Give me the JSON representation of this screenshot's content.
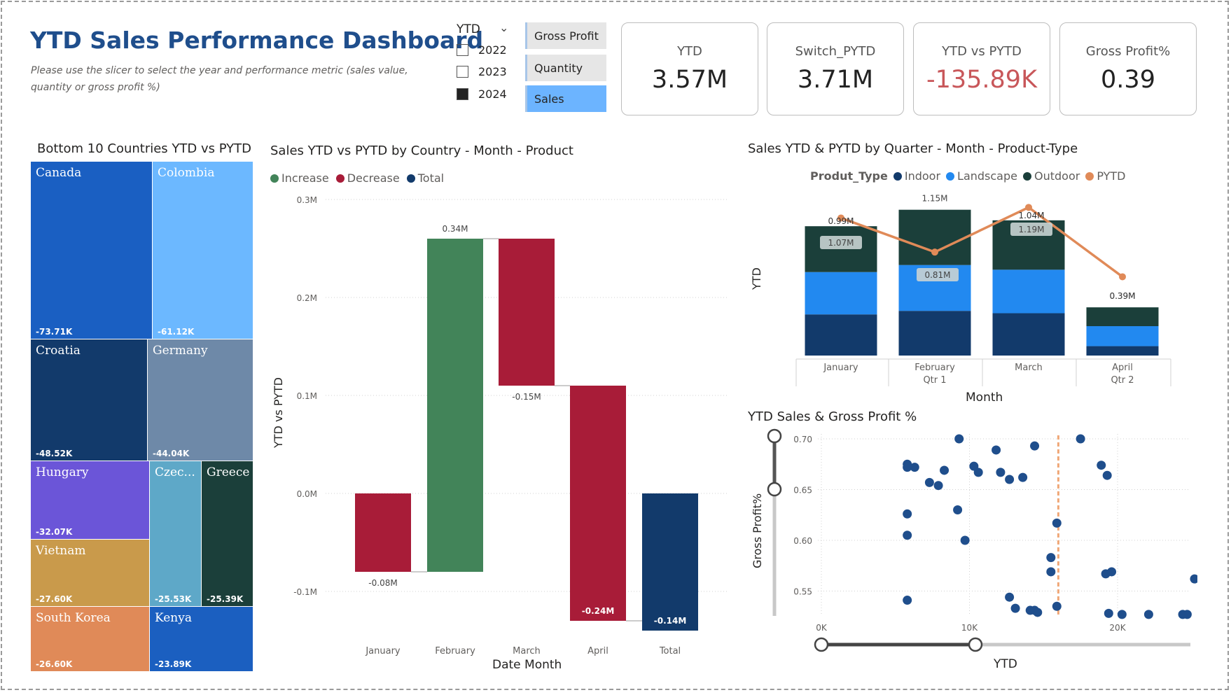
{
  "header": {
    "title": "YTD Sales Performance Dashboard",
    "subtitle": "Please use the slicer to select the year and performance metric (sales value, quantity or gross profit %)"
  },
  "year_slicer": {
    "label": "YTD",
    "years": [
      {
        "label": "2022",
        "checked": false
      },
      {
        "label": "2023",
        "checked": false
      },
      {
        "label": "2024",
        "checked": true
      }
    ]
  },
  "metric_slicer": {
    "options": [
      "Gross Profit",
      "Quantity",
      "Sales"
    ],
    "selected": "Sales"
  },
  "cards": [
    {
      "label": "YTD",
      "value": "3.57M"
    },
    {
      "label": "Switch_PYTD",
      "value": "3.71M"
    },
    {
      "label": "YTD vs PYTD",
      "value": "-135.89K"
    },
    {
      "label": "Gross Profit%",
      "value": "0.39"
    }
  ],
  "treemap": {
    "title": "Bottom 10 Countries YTD vs PYTD",
    "items": [
      {
        "name": "Canada",
        "value": "-73.71K",
        "color": "#1a5fc2"
      },
      {
        "name": "Colombia",
        "value": "-61.12K",
        "color": "#6cb8ff"
      },
      {
        "name": "Croatia",
        "value": "-48.52K",
        "color": "#123a6b"
      },
      {
        "name": "Germany",
        "value": "-44.04K",
        "color": "#6e89a8"
      },
      {
        "name": "Hungary",
        "value": "-32.07K",
        "color": "#6b55d8"
      },
      {
        "name": "Vietnam",
        "value": "-27.60K",
        "color": "#c99a4b"
      },
      {
        "name": "Czec...",
        "value": "-25.53K",
        "color": "#5ea8c8"
      },
      {
        "name": "Greece",
        "value": "-25.39K",
        "color": "#1b3f3a"
      },
      {
        "name": "South Korea",
        "value": "-26.60K",
        "color": "#e08a58"
      },
      {
        "name": "Kenya",
        "value": "-23.89K",
        "color": "#1b5fc0"
      }
    ]
  },
  "waterfall": {
    "title": "Sales YTD vs PYTD by Country - Month - Product",
    "legend": [
      {
        "label": "Increase",
        "color": "#428459"
      },
      {
        "label": "Decrease",
        "color": "#a81c38"
      },
      {
        "label": "Total",
        "color": "#123a6b"
      }
    ],
    "ylabel": "YTD vs PYTD",
    "xlabel": "Date Month",
    "yticks": [
      "0.3M",
      "0.2M",
      "0.1M",
      "0.0M",
      "-0.1M"
    ]
  },
  "stacked": {
    "title": "Sales YTD & PYTD by Quarter - Month - Product-Type",
    "legend_title": "Produt_Type",
    "legend": [
      {
        "label": "Indoor",
        "color": "#123a6b"
      },
      {
        "label": "Landscape",
        "color": "#2289f0"
      },
      {
        "label": "Outdoor",
        "color": "#1b3f3a"
      },
      {
        "label": "PYTD",
        "color": "#e08a58"
      }
    ],
    "ylabel": "YTD",
    "xlabel": "Month"
  },
  "scatter": {
    "title": "YTD Sales & Gross Profit %",
    "ylabel": "Gross Profit%",
    "xlabel": "YTD"
  },
  "chart_data": [
    {
      "type": "waterfall",
      "title": "Sales YTD vs PYTD by Country - Month - Product",
      "categories": [
        "January",
        "February",
        "March",
        "April",
        "Total"
      ],
      "values": [
        -0.08,
        0.34,
        -0.15,
        -0.24,
        -0.14
      ],
      "labels": [
        "-0.08M",
        "0.34M",
        "-0.15M",
        "-0.24M",
        "-0.14M"
      ],
      "kinds": [
        "decrease",
        "increase",
        "decrease",
        "decrease",
        "total"
      ],
      "ylim": [
        -0.136,
        0.3
      ],
      "yticks": [
        0.3,
        0.2,
        0.1,
        0.0,
        -0.1
      ],
      "xlabel": "Date Month",
      "ylabel": "YTD vs PYTD"
    },
    {
      "type": "bar",
      "stacked": true,
      "title": "Sales YTD & PYTD by Quarter - Month - Product-Type",
      "categories": [
        "January",
        "February",
        "March",
        "April"
      ],
      "category_sublabels": [
        "",
        "Qtr 1",
        "",
        "Qtr 2"
      ],
      "series": [
        {
          "name": "Indoor",
          "values": [
            0.35,
            0.38,
            0.36,
            0.08
          ]
        },
        {
          "name": "Landscape",
          "values": [
            0.36,
            0.39,
            0.37,
            0.17
          ]
        },
        {
          "name": "Outdoor",
          "values": [
            0.39,
            0.47,
            0.42,
            0.16
          ]
        }
      ],
      "totals_labels": [
        "",
        "1.15M",
        "",
        "0.39M"
      ],
      "line": {
        "name": "PYTD",
        "values": [
          1.17,
          0.88,
          1.26,
          0.67
        ]
      },
      "annotations": [
        {
          "category": "January",
          "labels": [
            "0.99M",
            "1.07M"
          ]
        },
        {
          "category": "February",
          "labels": [
            "0.81M"
          ]
        },
        {
          "category": "March",
          "labels": [
            "1.04M",
            "1.19M"
          ]
        }
      ],
      "xlabel": "Month",
      "ylabel": "YTD"
    },
    {
      "type": "scatter",
      "title": "YTD Sales & Gross Profit %",
      "xlabel": "YTD",
      "ylabel": "Gross Profit%",
      "xlim": [
        0,
        25500
      ],
      "ylim": [
        0.527,
        0.705
      ],
      "xticks": [
        "0K",
        "10K",
        "20K"
      ],
      "yticks": [
        "0.70",
        "0.65",
        "0.60",
        "0.55"
      ],
      "reference_x": 16000,
      "points": [
        [
          5800,
          0.675
        ],
        [
          5800,
          0.672
        ],
        [
          6300,
          0.672
        ],
        [
          7300,
          0.657
        ],
        [
          7900,
          0.654
        ],
        [
          8300,
          0.669
        ],
        [
          9200,
          0.63
        ],
        [
          9300,
          0.7
        ],
        [
          9700,
          0.6
        ],
        [
          10300,
          0.673
        ],
        [
          10600,
          0.667
        ],
        [
          11800,
          0.689
        ],
        [
          12100,
          0.667
        ],
        [
          12700,
          0.66
        ],
        [
          13600,
          0.662
        ],
        [
          14400,
          0.693
        ],
        [
          15900,
          0.617
        ],
        [
          5800,
          0.626
        ],
        [
          5800,
          0.605
        ],
        [
          5800,
          0.541
        ],
        [
          12700,
          0.544
        ],
        [
          13100,
          0.533
        ],
        [
          14100,
          0.531
        ],
        [
          14400,
          0.531
        ],
        [
          14600,
          0.529
        ],
        [
          15500,
          0.583
        ],
        [
          15500,
          0.569
        ],
        [
          15900,
          0.535
        ],
        [
          17500,
          0.7
        ],
        [
          18900,
          0.674
        ],
        [
          19300,
          0.664
        ],
        [
          19200,
          0.567
        ],
        [
          19600,
          0.569
        ],
        [
          19400,
          0.528
        ],
        [
          20300,
          0.527
        ],
        [
          22100,
          0.527
        ],
        [
          24400,
          0.527
        ],
        [
          24700,
          0.527
        ],
        [
          25200,
          0.562
        ]
      ]
    }
  ]
}
